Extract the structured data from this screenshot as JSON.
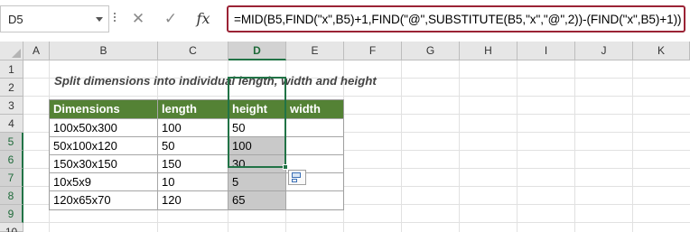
{
  "formula_bar": {
    "name_box": "D5",
    "cancel_symbol": "✕",
    "enter_symbol": "✓",
    "fx_label": "fx",
    "formula": "=MID(B5,FIND(\"x\",B5)+1,FIND(\"@\",SUBSTITUTE(B5,\"x\",\"@\",2))-(FIND(\"x\",B5)+1))"
  },
  "columns": [
    "A",
    "B",
    "C",
    "D",
    "E",
    "F",
    "G",
    "H",
    "I",
    "J",
    "K"
  ],
  "rows": [
    "1",
    "2",
    "3",
    "4",
    "5",
    "6",
    "7",
    "8",
    "9",
    "10"
  ],
  "title": "Split dimensions into individual length, width and height",
  "table": {
    "headers": [
      "Dimensions",
      "length",
      "height",
      "width"
    ],
    "rows": [
      [
        "100x50x300",
        "100",
        "50",
        ""
      ],
      [
        "50x100x120",
        "50",
        "100",
        ""
      ],
      [
        "150x30x150",
        "150",
        "30",
        ""
      ],
      [
        "10x5x9",
        "10",
        "5",
        ""
      ],
      [
        "120x65x70",
        "120",
        "65",
        ""
      ]
    ]
  },
  "icons": {
    "name_box_dropdown": "chevron-down-icon",
    "quick_analysis": "quick-analysis-icon",
    "select_all": "select-all-icon"
  },
  "colors": {
    "header_fill": "#548235",
    "selection": "#217346",
    "formula_border": "#9b2335",
    "filled_cell": "#c9c9c9"
  }
}
